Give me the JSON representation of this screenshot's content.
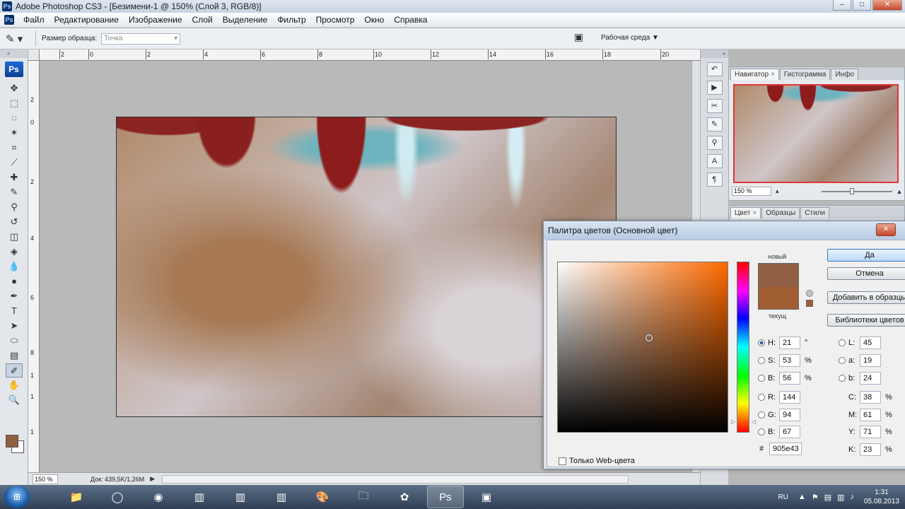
{
  "window": {
    "title": "Adobe Photoshop CS3 - [Безимени-1 @ 150% (Слой 3, RGB/8)]"
  },
  "menu": [
    "Файл",
    "Редактирование",
    "Изображение",
    "Слой",
    "Выделение",
    "Фильтр",
    "Просмотр",
    "Окно",
    "Справка"
  ],
  "options": {
    "sample_size_label": "Размер образца:",
    "sample_size_value": "Точка",
    "workspace_label": "Рабочая среда ▼"
  },
  "ruler": {
    "h_ticks": [
      "2",
      "0",
      "2",
      "4",
      "6",
      "8",
      "10",
      "12",
      "14",
      "16",
      "18",
      "20"
    ],
    "v_ticks": [
      "2",
      "0",
      "2",
      "4",
      "6",
      "8",
      "1",
      "1",
      "1"
    ]
  },
  "status": {
    "zoom": "150 %",
    "doc": "Док: 439,5K/1,26M"
  },
  "navigator": {
    "tabs": [
      "Навигатор",
      "Гистограмма",
      "Инфо"
    ],
    "zoom": "150 %"
  },
  "colorpanel": {
    "tabs": [
      "Цвет",
      "Образцы",
      "Стили"
    ]
  },
  "dialog": {
    "title": "Палитра цветов (Основной цвет)",
    "new_label": "новый",
    "current_label": "текущ",
    "buttons": {
      "ok": "Да",
      "cancel": "Отмена",
      "add": "Добавить в образцы",
      "libraries": "Библиотеки цветов"
    },
    "hsb": [
      {
        "label": "H:",
        "value": "21",
        "unit": "°"
      },
      {
        "label": "S:",
        "value": "53",
        "unit": "%"
      },
      {
        "label": "B:",
        "value": "56",
        "unit": "%"
      }
    ],
    "rgb": [
      {
        "label": "R:",
        "value": "144"
      },
      {
        "label": "G:",
        "value": "94"
      },
      {
        "label": "B:",
        "value": "67"
      }
    ],
    "lab": [
      {
        "label": "L:",
        "value": "45"
      },
      {
        "label": "a:",
        "value": "19"
      },
      {
        "label": "b:",
        "value": "24"
      }
    ],
    "cmyk": [
      {
        "label": "C:",
        "value": "38",
        "unit": "%"
      },
      {
        "label": "M:",
        "value": "61",
        "unit": "%"
      },
      {
        "label": "Y:",
        "value": "71",
        "unit": "%"
      },
      {
        "label": "K:",
        "value": "23",
        "unit": "%"
      }
    ],
    "hex_label": "#",
    "hex": "905e43",
    "web_only": "Только Web-цвета",
    "new_color": "#905e43",
    "current_color": "#a15d32"
  },
  "taskbar": {
    "lang": "RU",
    "time": "1:31",
    "date": "05.08.2013"
  },
  "colors": {
    "foreground": "#905e43"
  }
}
